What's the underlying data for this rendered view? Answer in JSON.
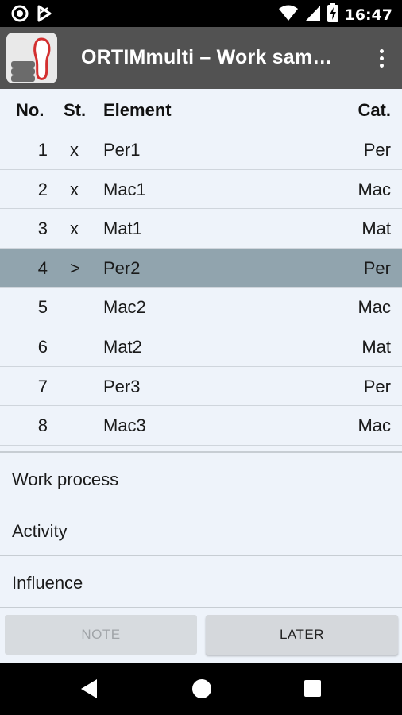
{
  "status_bar": {
    "time": "16:47",
    "icons": [
      "circle-notification-icon",
      "play-store-icon",
      "wifi-icon",
      "signal-icon",
      "battery-charging-icon"
    ]
  },
  "app_bar": {
    "title": "ORTIMmulti – Work sam…",
    "logo": "ortim-footprint-logo",
    "menu_icon": "overflow-menu-icon"
  },
  "table": {
    "headers": {
      "no": "No.",
      "st": "St.",
      "element": "Element",
      "cat": "Cat."
    },
    "rows": [
      {
        "no": "1",
        "st": "x",
        "element": "Per1",
        "cat": "Per",
        "selected": false
      },
      {
        "no": "2",
        "st": "x",
        "element": "Mac1",
        "cat": "Mac",
        "selected": false
      },
      {
        "no": "3",
        "st": "x",
        "element": "Mat1",
        "cat": "Mat",
        "selected": false
      },
      {
        "no": "4",
        "st": ">",
        "element": "Per2",
        "cat": "Per",
        "selected": true
      },
      {
        "no": "5",
        "st": "",
        "element": "Mac2",
        "cat": "Mac",
        "selected": false
      },
      {
        "no": "6",
        "st": "",
        "element": "Mat2",
        "cat": "Mat",
        "selected": false
      },
      {
        "no": "7",
        "st": "",
        "element": "Per3",
        "cat": "Per",
        "selected": false
      },
      {
        "no": "8",
        "st": "",
        "element": "Mac3",
        "cat": "Mac",
        "selected": false
      }
    ]
  },
  "sections": [
    {
      "label": "Work process"
    },
    {
      "label": "Activity"
    },
    {
      "label": "Influence"
    }
  ],
  "buttons": {
    "note": "NOTE",
    "later": "LATER"
  },
  "colors": {
    "appbar": "#525252",
    "background": "#eef3fa",
    "selected_row": "#91a4ae",
    "logo_accent": "#d32f2f"
  }
}
